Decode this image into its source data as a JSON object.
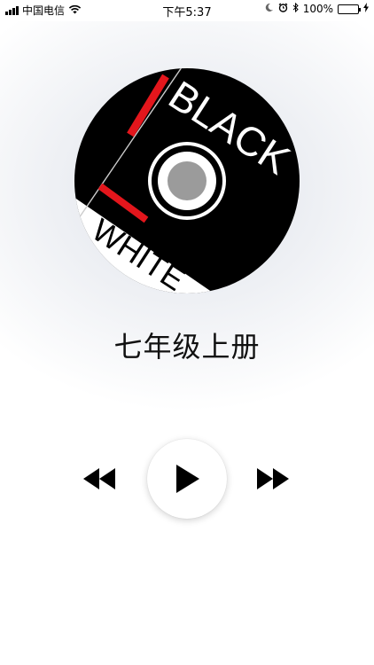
{
  "status_bar": {
    "carrier": "中国电信",
    "time": "下午5:37",
    "battery_percent": "100%",
    "battery_level": 1.0
  },
  "album": {
    "cover_text_top": "BLACK",
    "cover_text_bottom": "WHITE"
  },
  "player": {
    "title": "七年级上册"
  },
  "icons": {
    "rewind": "rewind-icon",
    "play": "play-icon",
    "fast_forward": "fast-forward-icon"
  }
}
